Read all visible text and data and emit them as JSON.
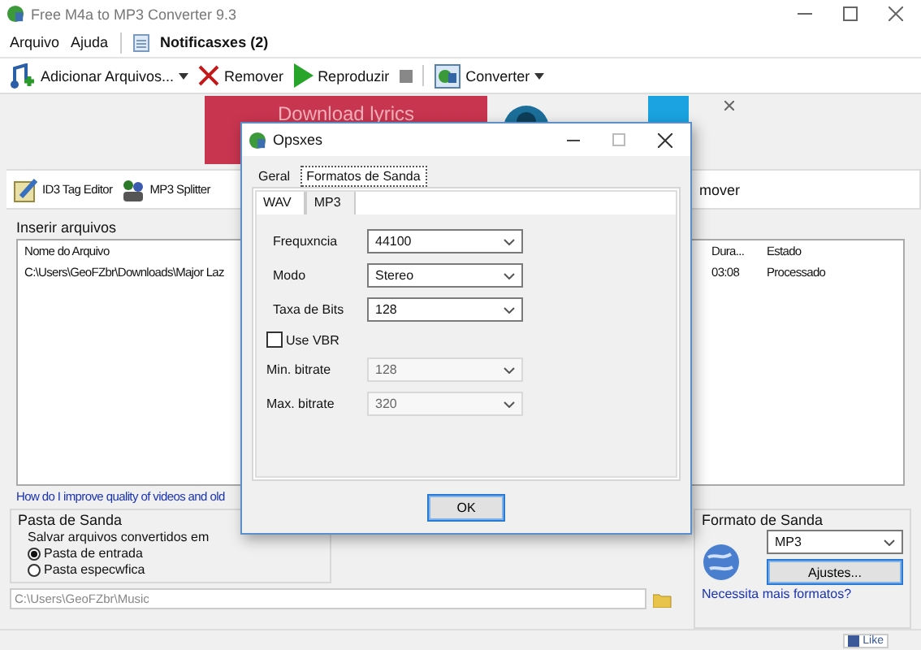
{
  "window": {
    "title": "Free M4a to MP3 Converter 9.3"
  },
  "menu": [
    {
      "label": "Arquivo"
    },
    {
      "label": "Ajuda"
    }
  ],
  "notifications": {
    "label": "Notificasxes (2)"
  },
  "toolbar": [
    {
      "kind": "dropdown",
      "label": "Adicionar Arquivos..."
    },
    {
      "kind": "button",
      "label": "Remover"
    },
    {
      "kind": "button",
      "label": "Reproduzir"
    },
    {
      "kind": "stop"
    },
    {
      "kind": "dropdown",
      "label": "Converter"
    }
  ],
  "ad": {
    "text": "Download lyrics"
  },
  "tools": [
    {
      "label": "ID3 Tag Editor"
    },
    {
      "label": "MP3 Splitter"
    },
    {
      "label": "mover"
    }
  ],
  "files": {
    "title": "Inserir arquivos",
    "columns": [
      "Nome do Arquivo",
      "Dura...",
      "Estado"
    ],
    "rows": [
      [
        "C:\\Users\\GeoFZbr\\Downloads\\Major Laz",
        "03:08",
        "Processado"
      ]
    ]
  },
  "help_link": "How do I improve quality of videos and old",
  "output_folder": {
    "title": "Pasta de Sanda",
    "caption": "Salvar arquivos convertidos em",
    "options": [
      {
        "label": "Pasta de entrada",
        "selected": true
      },
      {
        "label": "Pasta especwfica",
        "selected": false
      }
    ],
    "path": "C:\\Users\\GeoFZbr\\Music"
  },
  "output_format": {
    "title": "Formato de Sanda",
    "format": "MP3",
    "settings_button": "Ajustes...",
    "link": "Necessita mais formatos?"
  },
  "status_bar": {
    "like": "Like"
  },
  "dialog": {
    "title": "Opsxes",
    "tabs": [
      {
        "label": "Geral",
        "selected": false
      },
      {
        "label": "Formatos de Sanda",
        "selected": true
      }
    ],
    "subtabs": [
      {
        "label": "WAV",
        "selected": false
      },
      {
        "label": "MP3",
        "selected": true
      }
    ],
    "fields": [
      {
        "label": "Frequxncia",
        "value": "44100",
        "disabled": false
      },
      {
        "label": "Modo",
        "value": "Stereo",
        "disabled": false
      },
      {
        "label": "Taxa de Bits",
        "value": "128",
        "disabled": false
      }
    ],
    "vbr": {
      "label": "Use VBR",
      "checked": false
    },
    "vbr_fields": [
      {
        "label": "Min. bitrate",
        "value": "128",
        "disabled": true
      },
      {
        "label": "Max. bitrate",
        "value": "320",
        "disabled": true
      }
    ],
    "ok": "OK"
  }
}
